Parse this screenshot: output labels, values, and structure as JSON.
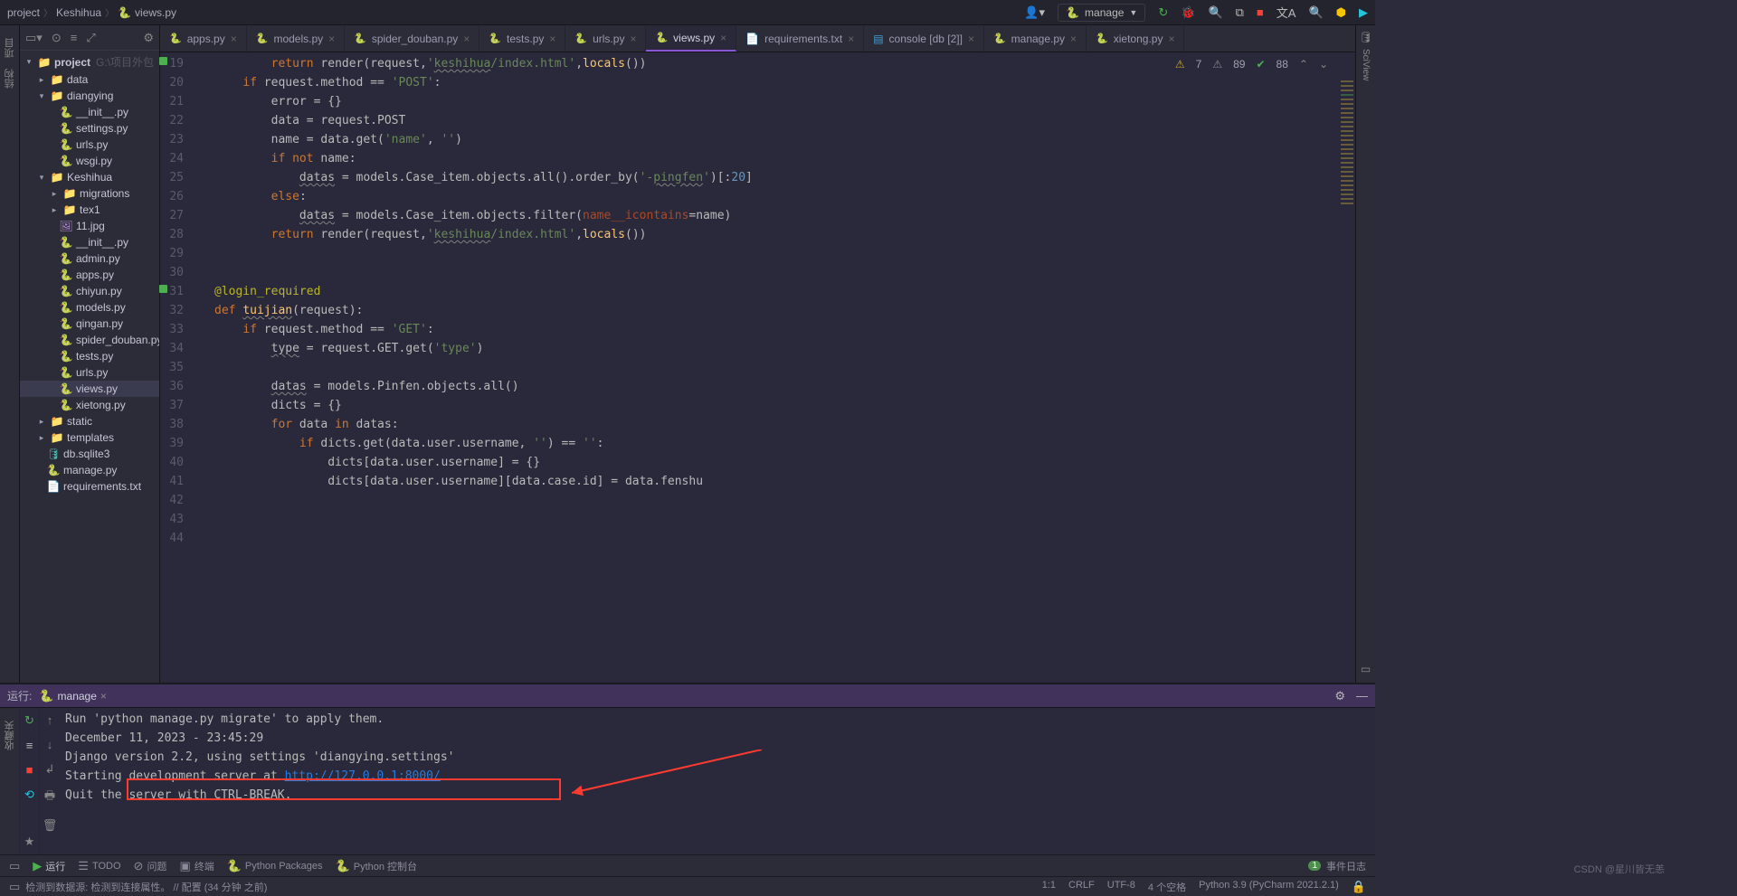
{
  "breadcrumb": {
    "project": "project",
    "pkg": "Keshihua",
    "file": "views.py"
  },
  "run_config": {
    "label": "manage"
  },
  "project_tree": {
    "root": {
      "name": "project",
      "path": "G:\\项目外包"
    },
    "data": "data",
    "diangying": "diangying",
    "init": "__init__.py",
    "settings": "settings.py",
    "urls": "urls.py",
    "wsgi": "wsgi.py",
    "Keshihua": "Keshihua",
    "migrations": "migrations",
    "tex1": "tex1",
    "jpg": "11.jpg",
    "init2": "__init__.py",
    "admin": "admin.py",
    "apps": "apps.py",
    "chiyun": "chiyun.py",
    "models": "models.py",
    "qingan": "qingan.py",
    "spider": "spider_douban.py",
    "tests": "tests.py",
    "urls2": "urls.py",
    "views": "views.py",
    "xietong": "xietong.py",
    "static": "static",
    "templates": "templates",
    "db": "db.sqlite3",
    "manage": "manage.py",
    "req": "requirements.txt"
  },
  "tabs": {
    "apps": "apps.py",
    "models": "models.py",
    "spider": "spider_douban.py",
    "tests": "tests.py",
    "urls": "urls.py",
    "views": "views.py",
    "req": "requirements.txt",
    "console": "console [db [2]]",
    "manage": "manage.py",
    "xietong": "xietong.py"
  },
  "inspect": {
    "warn": "7",
    "weak": "89",
    "typo": "88"
  },
  "code": {
    "lines_start": 19,
    "lines_end": 44,
    "l19": "return render(request,'keshihua/index.html',locals())",
    "l20": "if request.method == 'POST':",
    "l21": "error = {}",
    "l22": "data = request.POST",
    "l23": "name = data.get('name', '')",
    "l24": "if not name:",
    "l25": "datas = models.Case_item.objects.all().order_by('-pingfen')[:20]",
    "l26": "else:",
    "l27": "datas = models.Case_item.objects.filter(name__icontains=name)",
    "l28": "return render(request,'keshihua/index.html',locals())",
    "l34": "@login_required",
    "l35": "def tuijian(request):",
    "l36": "if request.method == 'GET':",
    "l37": "type = request.GET.get('type')",
    "l39": "datas = models.Pinfen.objects.all()",
    "l40": "dicts = {}",
    "l41": "for data in datas:",
    "l42": "if dicts.get(data.user.username, '') == '':",
    "l43": "dicts[data.user.username] = {}",
    "l44": "dicts[data.user.username][data.case.id] = data.fenshu"
  },
  "run_panel": {
    "label": "运行:",
    "tab": "manage",
    "lines": {
      "l1": "Run 'python manage.py migrate' to apply them.",
      "l2": "December 11, 2023 - 23:45:29",
      "l3": "Django version 2.2, using settings 'diangying.settings'",
      "l4_prefix": "Starting development server at ",
      "l4_link": "http://127.0.0.1:8000/",
      "l5": "Quit the server with CTRL-BREAK."
    }
  },
  "bottom_tools": {
    "run": "运行",
    "todo": "TODO",
    "problems": "问题",
    "terminal": "终端",
    "pypkg": "Python Packages",
    "pycon": "Python 控制台",
    "events": "事件日志"
  },
  "status": {
    "left": "检测到数据源: 检测到连接属性。  // 配置 (34 分钟 之前)",
    "pos": "1:1",
    "crlf": "CRLF",
    "enc": "UTF-8",
    "indent": "4 个空格",
    "py": "Python 3.9 (PyCharm 2021.2.1)"
  },
  "watermark": "CSDN @星川皆无恙"
}
